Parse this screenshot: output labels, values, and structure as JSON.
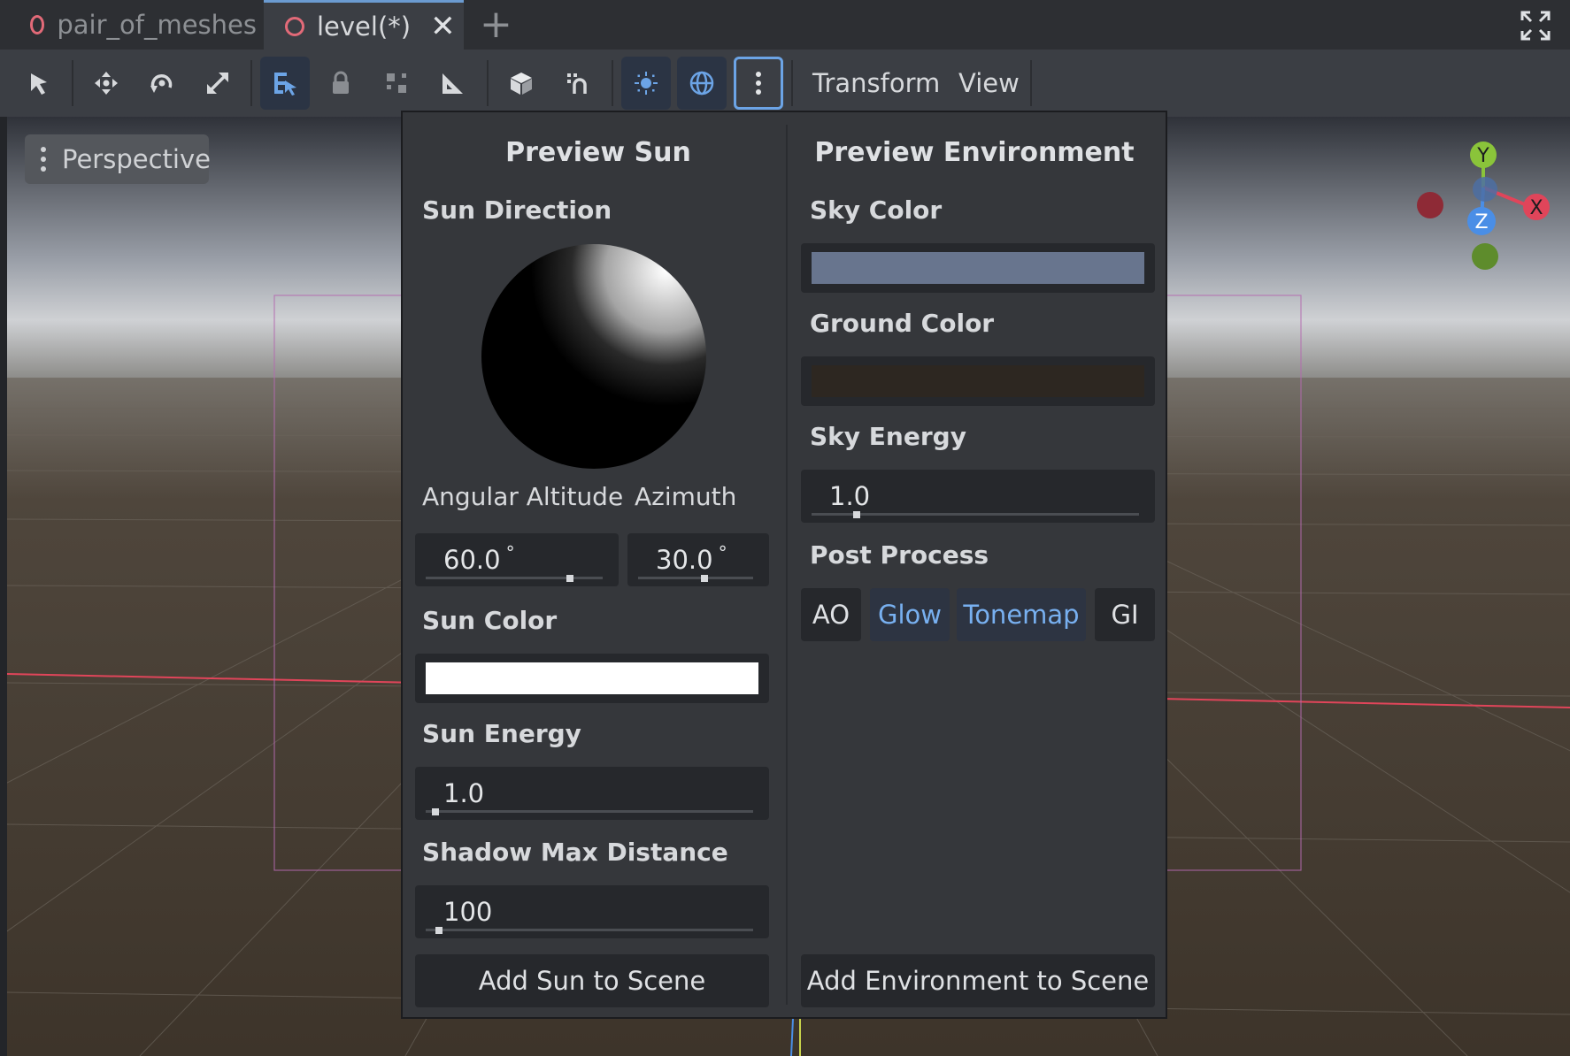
{
  "tabs": [
    {
      "label": "pair_of_meshes",
      "active": false
    },
    {
      "label": "level(*)",
      "active": true
    }
  ],
  "tab_close_glyph": "✕",
  "tab_add_glyph": "+",
  "toolbar": {
    "tools": [
      "select-icon",
      "move-icon",
      "rotate-icon",
      "scale-icon",
      "list-select-icon",
      "lock-icon",
      "group-icon",
      "ruler-icon",
      "local-space-icon",
      "snap-icon",
      "preview-sun-icon",
      "preview-environment-icon",
      "more-options-icon"
    ],
    "menus": {
      "transform": "Transform",
      "view": "View"
    }
  },
  "viewport": {
    "perspective_label": "Perspective"
  },
  "popup": {
    "sun": {
      "title": "Preview Sun",
      "direction_label": "Sun Direction",
      "altitude_label": "Angular Altitude",
      "azimuth_label": "Azimuth",
      "altitude_value": "60.0",
      "azimuth_value": "30.0",
      "degree_unit": "°",
      "altitude_slider_fraction": 0.83,
      "azimuth_slider_fraction": 0.58,
      "color_label": "Sun Color",
      "color": "#ffffff",
      "energy_label": "Sun Energy",
      "energy_value": "1.0",
      "energy_slider_fraction": 0.02,
      "shadow_label": "Shadow Max Distance",
      "shadow_value": "100",
      "shadow_slider_fraction": 0.03,
      "add_button": "Add Sun to Scene"
    },
    "environment": {
      "title": "Preview Environment",
      "sky_color_label": "Sky Color",
      "sky_color": "#68758e",
      "ground_color_label": "Ground Color",
      "ground_color": "#2d2721",
      "sky_energy_label": "Sky Energy",
      "sky_energy_value": "1.0",
      "sky_energy_slider_fraction": 0.13,
      "post_process_label": "Post Process",
      "post_process_buttons": [
        {
          "label": "AO",
          "on": false
        },
        {
          "label": "Glow",
          "on": true
        },
        {
          "label": "Tonemap",
          "on": true
        },
        {
          "label": "GI",
          "on": false
        }
      ],
      "add_button": "Add Environment to Scene"
    }
  },
  "gizmo": {
    "x_label": "X",
    "y_label": "Y",
    "z_label": "Z"
  },
  "colors": {
    "accent": "#6ca4e6",
    "axis_x": "#e0455a",
    "axis_y": "#8ac43a",
    "axis_z": "#4a8ee6"
  }
}
